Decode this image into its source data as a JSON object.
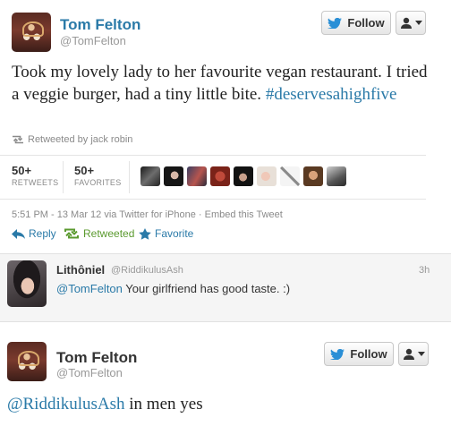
{
  "tweet": {
    "author": "Tom Felton",
    "handle": "@TomFelton",
    "follow_label": "Follow",
    "text": "Took my lovely lady to her favourite vegan restaurant. I tried a veggie burger, had a tiny little bite.",
    "hashtag": "#deservesahighfive",
    "retweeted_by": "Retweeted by jack robin",
    "retweets_count": "50+",
    "retweets_label": "RETWEETS",
    "favorites_count": "50+",
    "favorites_label": "FAVORITES",
    "meta": "5:51 PM - 13 Mar 12 via Twitter for iPhone · Embed this Tweet",
    "actions": {
      "reply": "Reply",
      "retweeted": "Retweeted",
      "favorite": "Favorite"
    }
  },
  "reply": {
    "author": "Lithôniel",
    "handle": "@RiddikulusAsh",
    "time": "3h",
    "mention": "@TomFelton",
    "text": " Your girlfriend has good taste. :)"
  },
  "response": {
    "author": "Tom Felton",
    "handle": "@TomFelton",
    "follow_label": "Follow",
    "mention": "@RiddikulusAsh",
    "text": " in men yes"
  },
  "favoriters": [
    "avatar-1",
    "avatar-2",
    "avatar-3",
    "avatar-4",
    "avatar-5",
    "avatar-6",
    "avatar-7",
    "avatar-8",
    "avatar-9"
  ],
  "colors": {
    "link": "#2a7aa8",
    "retweeted": "#5b9a2f",
    "handle": "#999999",
    "reply_bg": "#f5f5f5"
  }
}
